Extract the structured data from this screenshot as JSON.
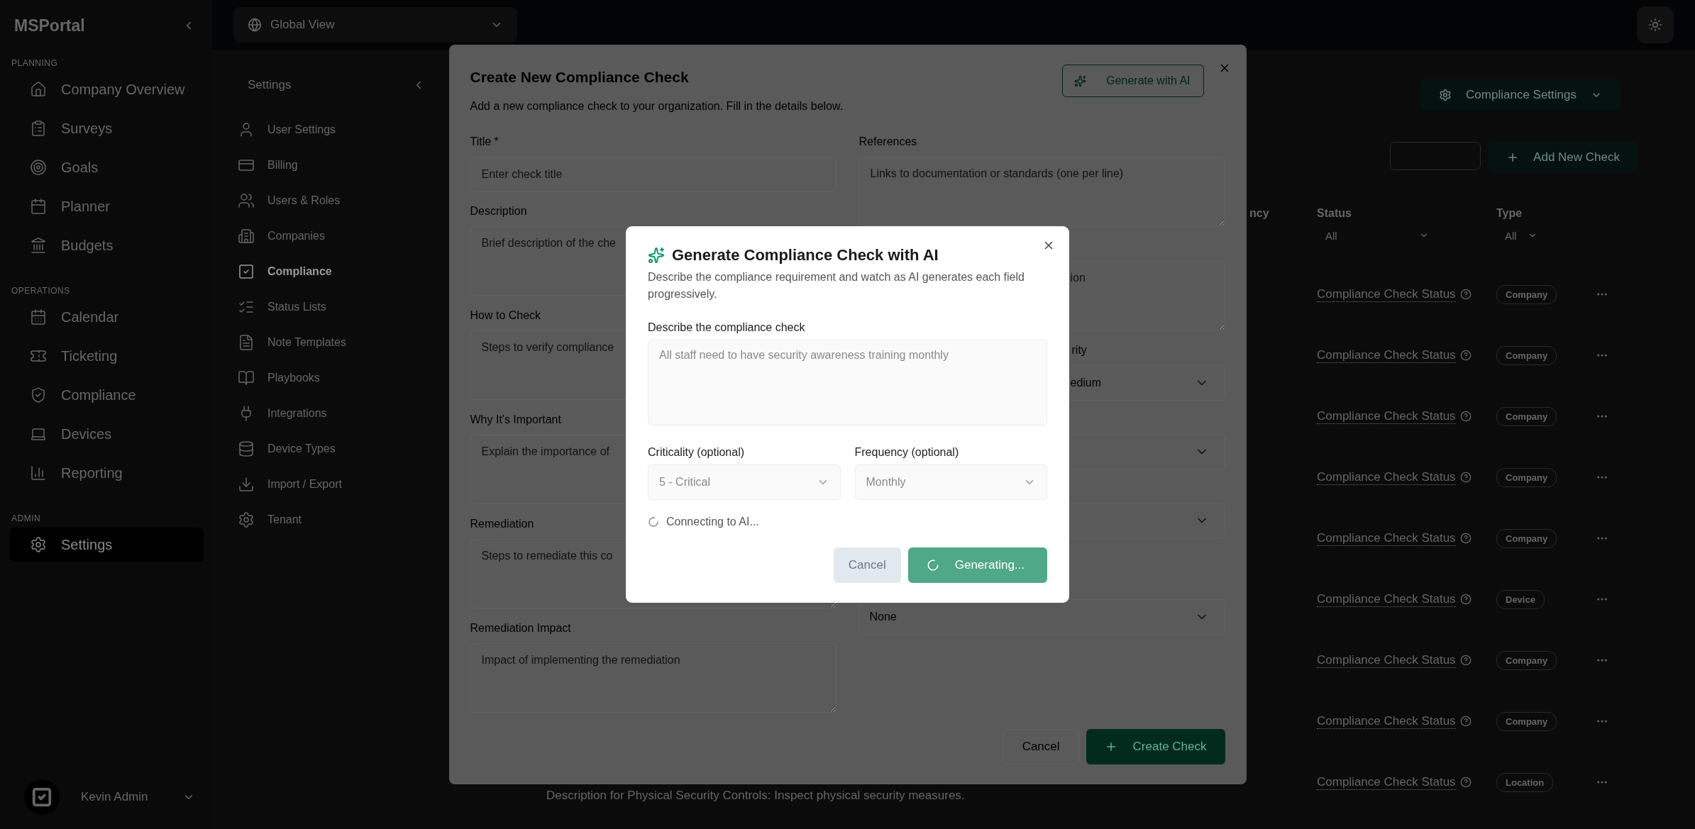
{
  "sidebar": {
    "brand": "MSPortal",
    "sections": [
      {
        "title": "PLANNING",
        "items": [
          {
            "label": "Company Overview",
            "selected": false
          },
          {
            "label": "Surveys",
            "selected": false
          },
          {
            "label": "Goals",
            "selected": false
          },
          {
            "label": "Planner",
            "selected": false
          },
          {
            "label": "Budgets",
            "selected": false
          }
        ]
      },
      {
        "title": "OPERATIONS",
        "items": [
          {
            "label": "Calendar",
            "selected": false
          },
          {
            "label": "Ticketing",
            "selected": false
          },
          {
            "label": "Compliance",
            "selected": false
          },
          {
            "label": "Devices",
            "selected": false
          },
          {
            "label": "Reporting",
            "selected": false
          }
        ]
      },
      {
        "title": "ADMIN",
        "items": [
          {
            "label": "Settings",
            "selected": true
          }
        ]
      }
    ],
    "user": {
      "name": "Kevin Admin"
    }
  },
  "topbar": {
    "scope": "Global View"
  },
  "settings_nav": {
    "title": "Settings",
    "items": [
      {
        "label": "User Settings",
        "selected": false
      },
      {
        "label": "Billing",
        "selected": false
      },
      {
        "label": "Users & Roles",
        "selected": false
      },
      {
        "label": "Companies",
        "selected": false
      },
      {
        "label": "Compliance",
        "selected": true
      },
      {
        "label": "Status Lists",
        "selected": false
      },
      {
        "label": "Note Templates",
        "selected": false
      },
      {
        "label": "Playbooks",
        "selected": false
      },
      {
        "label": "Integrations",
        "selected": false
      },
      {
        "label": "Device Types",
        "selected": false
      },
      {
        "label": "Import / Export",
        "selected": false
      },
      {
        "label": "Tenant",
        "selected": false
      }
    ]
  },
  "content": {
    "settings_button": "Compliance Settings",
    "add_button": "Add New Check",
    "table": {
      "columns": [
        {
          "label": "ncy"
        },
        {
          "label": "Status",
          "filter": "All"
        },
        {
          "label": "Type",
          "filter": "All"
        }
      ],
      "rows": [
        {
          "status": "Compliance Check Status",
          "type": "Company"
        },
        {
          "status": "Compliance Check Status",
          "type": "Company"
        },
        {
          "status": "Compliance Check Status",
          "type": "Company"
        },
        {
          "status": "Compliance Check Status",
          "type": "Company"
        },
        {
          "status": "Compliance Check Status",
          "type": "Company"
        },
        {
          "status": "Compliance Check Status",
          "type": "Device"
        },
        {
          "status": "Compliance Check Status",
          "type": "Company"
        },
        {
          "status": "Compliance Check Status",
          "type": "Company"
        },
        {
          "status": "Compliance Check Status",
          "type": "Location",
          "description": "Description for Physical Security Controls: Inspect physical security measures."
        }
      ]
    }
  },
  "create_dialog": {
    "title": "Create New Compliance Check",
    "subtitle": "Add a new compliance check to your organization. Fill in the details below.",
    "ai_button": "Generate with AI",
    "left_fields": [
      {
        "kind": "input",
        "label": "Title *",
        "placeholder": "Enter check title"
      },
      {
        "kind": "textarea",
        "label": "Description",
        "placeholder": "Brief description of the che"
      },
      {
        "kind": "textarea",
        "label": "How to Check",
        "placeholder": "Steps to verify compliance"
      },
      {
        "kind": "textarea",
        "label": "Why It's Important",
        "placeholder": "Explain the importance of"
      },
      {
        "kind": "textarea",
        "label": "Remediation",
        "placeholder": "Steps to remediate this co"
      },
      {
        "kind": "textarea",
        "label": "Remediation Impact",
        "placeholder": "Impact of implementing the remediation"
      }
    ],
    "right_fields": [
      {
        "kind": "textarea",
        "label": "References",
        "placeholder": "Links to documentation or standards (one per line)"
      },
      {
        "kind": "textarea",
        "placeholder": "ion",
        "cut": true
      },
      {
        "kind": "select",
        "label": "rity",
        "value": "edium",
        "cut": true
      },
      {
        "kind": "select"
      },
      {
        "kind": "select"
      },
      {
        "kind": "select",
        "value": "None"
      }
    ],
    "buttons": [
      {
        "label": "Cancel",
        "kind": "secondary"
      },
      {
        "label": "Create Check",
        "kind": "primary"
      }
    ]
  },
  "ai_dialog": {
    "title": "Generate Compliance Check with AI",
    "subtitle": "Describe the compliance requirement and watch as AI generates each field progressively.",
    "prompt": {
      "label": "Describe the compliance check",
      "placeholder": "All staff need to have security awareness training monthly",
      "disabled": true
    },
    "selects": [
      {
        "label": "Criticality (optional)",
        "value": "5 - Critical",
        "disabled": true
      },
      {
        "label": "Frequency (optional)",
        "value": "Monthly",
        "disabled": true
      }
    ],
    "status": "Connecting to AI...",
    "buttons": [
      {
        "label": "Cancel",
        "kind": "secondary",
        "disabled": true,
        "spinner": false
      },
      {
        "label": "Generating...",
        "kind": "primary",
        "disabled": true,
        "spinner": true
      }
    ]
  }
}
